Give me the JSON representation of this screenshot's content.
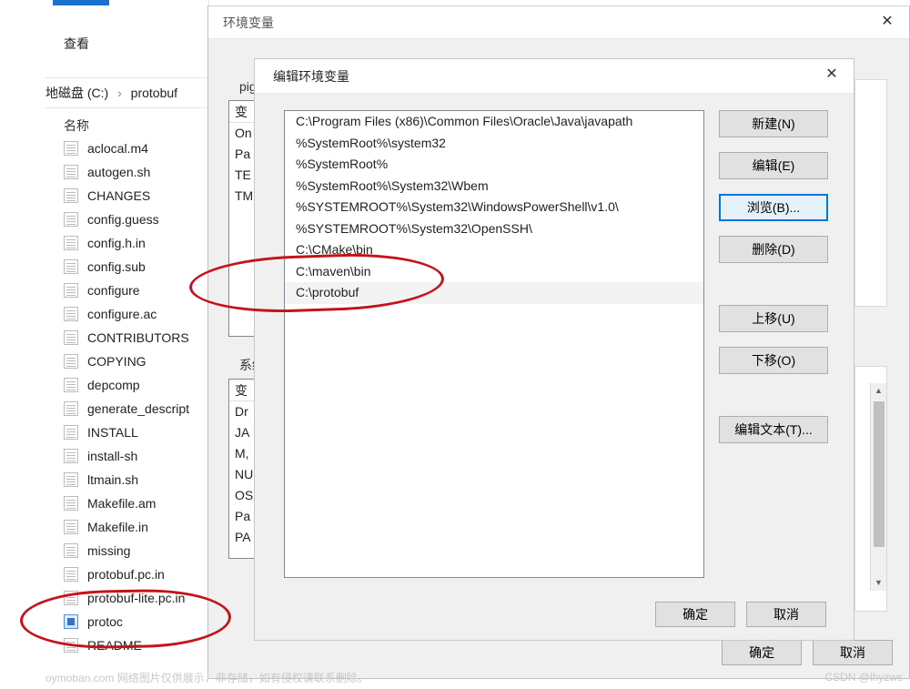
{
  "explorer": {
    "view_menu": "查看",
    "breadcrumb": {
      "drive": "地磁盘 (C:)",
      "sep": "›",
      "folder": "protobuf"
    },
    "name_header": "名称",
    "files": [
      {
        "name": "aclocal.m4",
        "icon": "lines"
      },
      {
        "name": "autogen.sh",
        "icon": "lines"
      },
      {
        "name": "CHANGES",
        "icon": "lines"
      },
      {
        "name": "config.guess",
        "icon": "lines"
      },
      {
        "name": "config.h.in",
        "icon": "lines"
      },
      {
        "name": "config.sub",
        "icon": "lines"
      },
      {
        "name": "configure",
        "icon": "lines"
      },
      {
        "name": "configure.ac",
        "icon": "lines"
      },
      {
        "name": "CONTRIBUTORS",
        "icon": "lines"
      },
      {
        "name": "COPYING",
        "icon": "lines"
      },
      {
        "name": "depcomp",
        "icon": "lines"
      },
      {
        "name": "generate_descript",
        "icon": "lines"
      },
      {
        "name": "INSTALL",
        "icon": "lines"
      },
      {
        "name": "install-sh",
        "icon": "lines"
      },
      {
        "name": "ltmain.sh",
        "icon": "lines"
      },
      {
        "name": "Makefile.am",
        "icon": "lines"
      },
      {
        "name": "Makefile.in",
        "icon": "lines"
      },
      {
        "name": "missing",
        "icon": "lines"
      },
      {
        "name": "protobuf.pc.in",
        "icon": "lines"
      },
      {
        "name": "protobuf-lite.pc.in",
        "icon": "lines"
      },
      {
        "name": "protoc",
        "icon": "exe"
      },
      {
        "name": "README",
        "icon": "lines"
      }
    ]
  },
  "envvar_dialog": {
    "title": "环境变量",
    "user_section_clip": "pig 的",
    "system_section": "系统",
    "user_header": "变",
    "user_items": [
      "On",
      "Pa",
      "TE",
      "TM"
    ],
    "sys_header": "变",
    "sys_items": [
      "Dr",
      "JA",
      "M,",
      "NU",
      "OS",
      "Pa",
      "PA"
    ],
    "ok": "确定",
    "cancel": "取消"
  },
  "edit_dialog": {
    "title": "编辑环境变量",
    "entries": [
      "C:\\Program Files (x86)\\Common Files\\Oracle\\Java\\javapath",
      "%SystemRoot%\\system32",
      "%SystemRoot%",
      "%SystemRoot%\\System32\\Wbem",
      "%SYSTEMROOT%\\System32\\WindowsPowerShell\\v1.0\\",
      "%SYSTEMROOT%\\System32\\OpenSSH\\",
      "C:\\CMake\\bin",
      "C:\\maven\\bin",
      "C:\\protobuf"
    ],
    "selected_index": 8,
    "buttons": {
      "new": "新建(N)",
      "edit": "编辑(E)",
      "browse": "浏览(B)...",
      "delete": "删除(D)",
      "up": "上移(U)",
      "down": "下移(O)",
      "edit_text": "编辑文本(T)..."
    },
    "ok": "确定",
    "cancel": "取消"
  },
  "footer": {
    "left": "oymoban.com 网络图片仅供展示，非存储，如有侵权请联系删除。",
    "right": "CSDN @lhyzws"
  }
}
